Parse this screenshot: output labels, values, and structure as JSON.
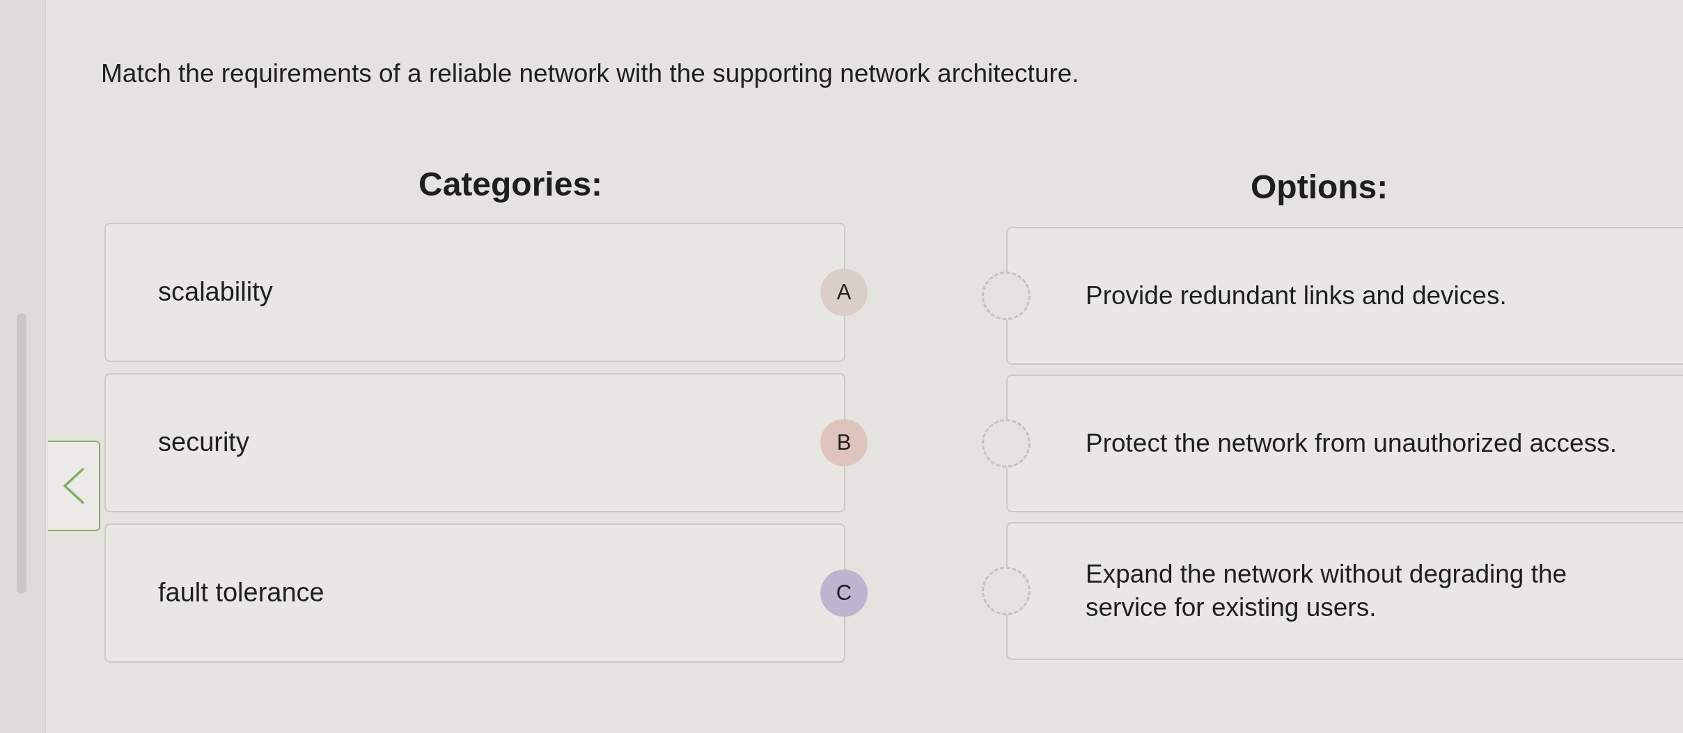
{
  "instruction": "Match the requirements of a reliable network with the supporting network architecture.",
  "categories": {
    "heading": "Categories:",
    "items": [
      {
        "label": "scalability",
        "letter": "A",
        "color": "#dbcec6"
      },
      {
        "label": "security",
        "letter": "B",
        "color": "#dfc4bd"
      },
      {
        "label": "fault tolerance",
        "letter": "C",
        "color": "#bcb5cf"
      }
    ]
  },
  "options": {
    "heading": "Options:",
    "items": [
      {
        "text": "Provide redundant links and devices."
      },
      {
        "text": "Protect the network from unauthorized access."
      },
      {
        "text": "Expand the network without degrading the service for existing users."
      }
    ]
  }
}
